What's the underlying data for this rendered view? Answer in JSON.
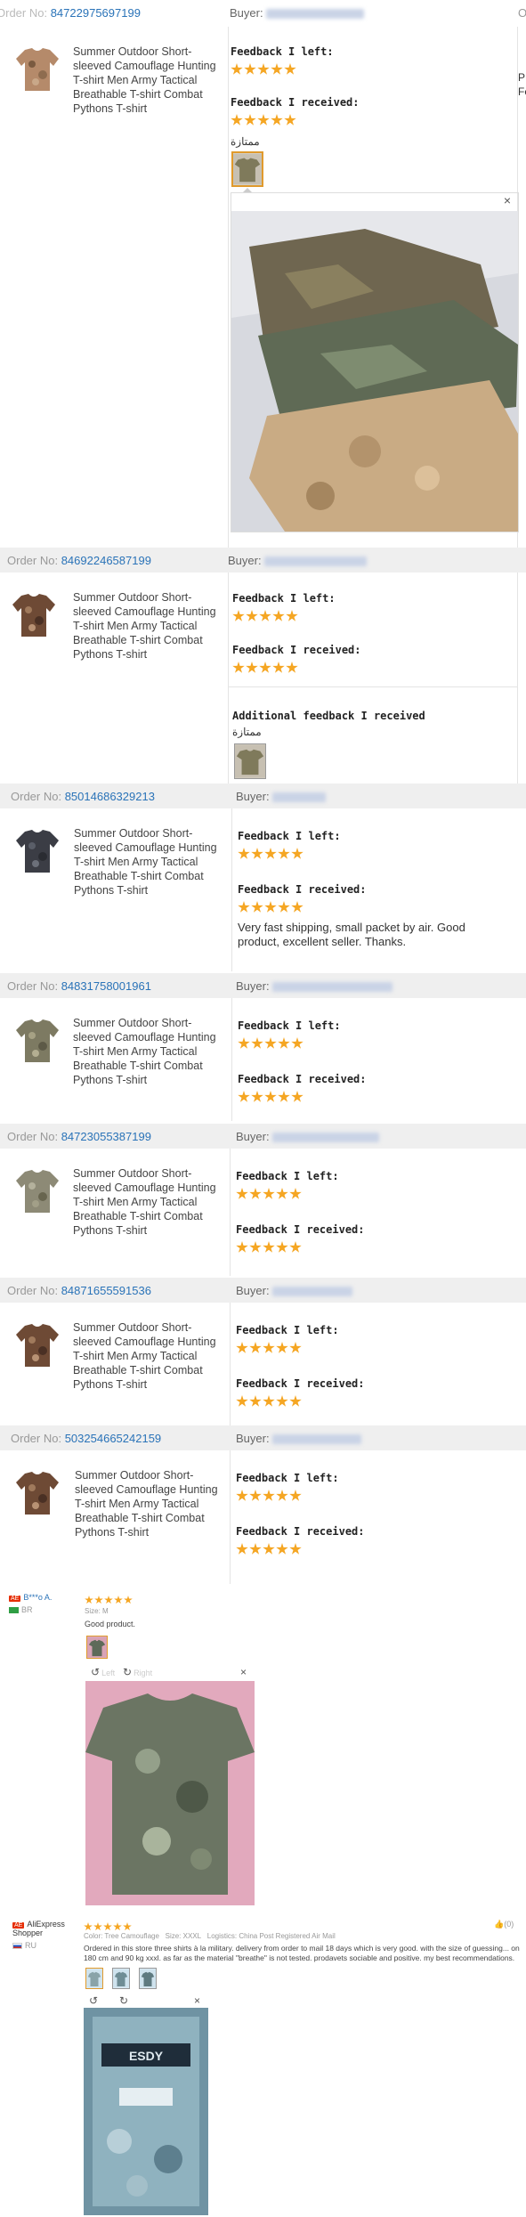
{
  "product_title": "Summer Outdoor Short-sleeved Camouflage Hunting T-shirt Men Army Tactical Breathable T-shirt Combat Pythons T-shirt",
  "labels": {
    "order_no": "Order No:",
    "buyer": "Buyer:",
    "feedback_left": "Feedback I left:",
    "feedback_received": "Feedback I received:",
    "additional_feedback": "Additional feedback I received",
    "close": "×"
  },
  "top_partial": {
    "order_no_prefix": "Order No:",
    "order_no": "84722975697199",
    "arabic": "ممتازة",
    "right_edge_1": "O",
    "right_edge_2": "P",
    "right_edge_3": "Fe"
  },
  "orders": [
    {
      "order_no": "84692246587199",
      "arabic": "ممتازة",
      "feedback_text": ""
    },
    {
      "order_no": "85014686329213",
      "feedback_text": "Very fast shipping, small packet by air. Good product, excellent seller. Thanks."
    },
    {
      "order_no": "84831758001961"
    },
    {
      "order_no": "84723055387199"
    },
    {
      "order_no": "84871655591536"
    },
    {
      "order_no": "503254665242159"
    }
  ],
  "reviews": [
    {
      "user": "B***o A.",
      "country": "BR",
      "size": "Size: M",
      "text": "Good product.",
      "rotate_left": "Left",
      "rotate_right": "Right"
    },
    {
      "user": "AliExpress Shopper",
      "country": "RU",
      "color": "Color: Tree Camouflage",
      "size": "Size: XXXL",
      "logistics": "Logistics: China Post Registered Air Mail",
      "helpful": "(0)",
      "text": "Ordered in this store three shirts à la military. delivery from order to mail 18 days which is very good. with the size of guessing... on 180 cm and 90 kg xxxl. as far as the material \"breathe\" is not tested. prodavets sociable and positive. my best recommendations."
    }
  ],
  "colors": {
    "link": "#2a73b8",
    "star": "#f5a623",
    "header_bg": "#efefef"
  }
}
